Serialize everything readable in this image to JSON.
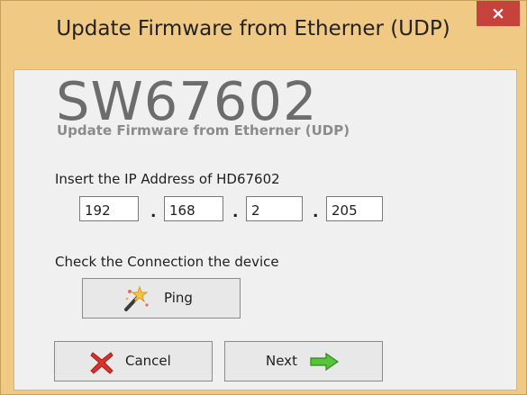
{
  "window": {
    "title": "Update Firmware from Etherner (UDP)",
    "close_glyph": "×"
  },
  "header": {
    "app_name": "SW67602",
    "subtitle": "Update Firmware from Etherner (UDP)"
  },
  "ip_section": {
    "label": "Insert the IP Address of HD67602",
    "octets": [
      "192",
      "168",
      "2",
      "205"
    ],
    "separator": "."
  },
  "connection": {
    "label": "Check the Connection the device",
    "ping_label": "Ping",
    "ping_icon": "magic-wand-icon"
  },
  "footer": {
    "cancel_label": "Cancel",
    "cancel_icon": "red-x-icon",
    "next_label": "Next",
    "next_icon": "green-arrow-icon"
  },
  "colors": {
    "frame": "#f0c984",
    "close": "#c7423a",
    "client_bg": "#f0f0f0"
  }
}
